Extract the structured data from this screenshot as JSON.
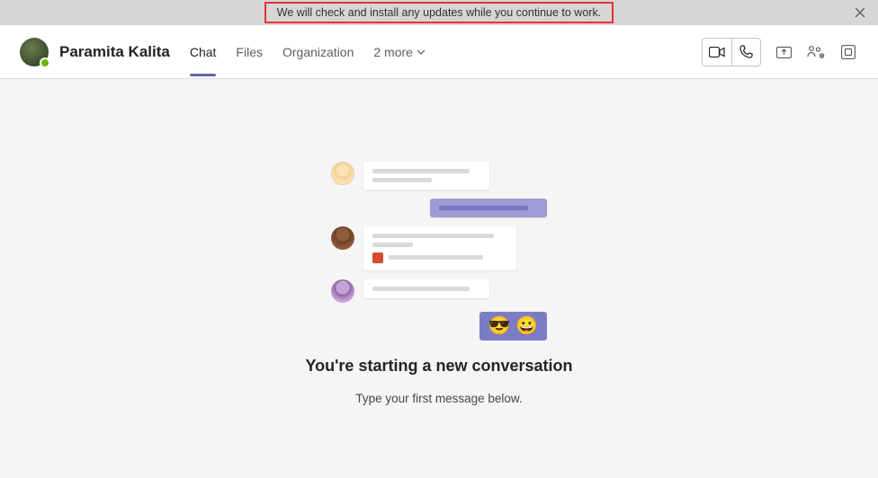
{
  "notification": {
    "text": "We will check and install any updates while you continue to work."
  },
  "header": {
    "contact_name": "Paramita Kalita",
    "tabs": {
      "chat": "Chat",
      "files": "Files",
      "organization": "Organization",
      "more": "2 more"
    }
  },
  "empty_state": {
    "headline": "You're starting a new conversation",
    "subline": "Type your first message below.",
    "emoji": "😎 😀"
  }
}
